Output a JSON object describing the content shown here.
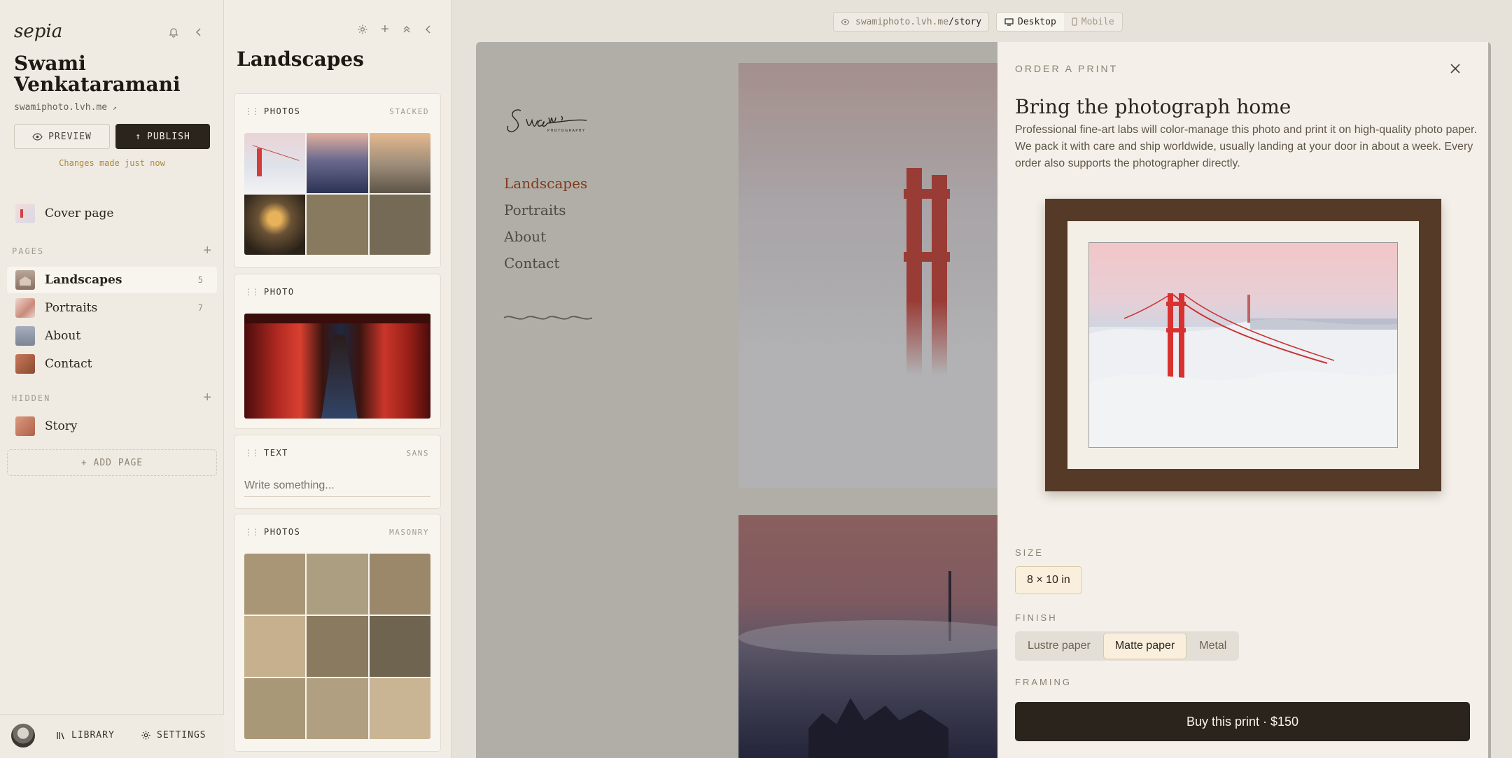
{
  "sidebar": {
    "brand": "sepia",
    "owner_name": "Swami Venkataramani",
    "site_url": "swamiphoto.lvh.me",
    "preview_label": "PREVIEW",
    "publish_label": "PUBLISH",
    "changes_status": "Changes made just now",
    "cover_label": "Cover page",
    "pages_heading": "PAGES",
    "pages": [
      {
        "label": "Landscapes",
        "count": "5"
      },
      {
        "label": "Portraits",
        "count": "7"
      },
      {
        "label": "About",
        "count": ""
      },
      {
        "label": "Contact",
        "count": ""
      }
    ],
    "hidden_heading": "HIDDEN",
    "hidden_pages": [
      {
        "label": "Story"
      }
    ],
    "add_page_label": "+ ADD PAGE",
    "library_label": "LIBRARY",
    "settings_label": "SETTINGS"
  },
  "panel": {
    "title": "Landscapes",
    "blocks": [
      {
        "label": "PHOTOS",
        "tag": "STACKED"
      },
      {
        "label": "PHOTO",
        "tag": ""
      },
      {
        "label": "TEXT",
        "tag": "SANS",
        "placeholder": "Write something..."
      },
      {
        "label": "PHOTOS",
        "tag": "MASONRY"
      }
    ]
  },
  "preview": {
    "url_host": "swamiphoto.lvh.me",
    "url_path": "/story",
    "device_desktop": "Desktop",
    "device_mobile": "Mobile",
    "site_nav": [
      "Landscapes",
      "Portraits",
      "About",
      "Contact"
    ]
  },
  "drawer": {
    "eyebrow": "ORDER A PRINT",
    "title": "Bring the photograph home",
    "description": "Professional fine-art labs will color-manage this photo and print it on high-quality photo paper. We pack it with care and ship worldwide, usually landing at your door in about a week. Every order also supports the photographer directly.",
    "size_label": "SIZE",
    "size_options": [
      "8 × 10 in"
    ],
    "finish_label": "FINISH",
    "finish_options": [
      "Lustre paper",
      "Matte paper",
      "Metal"
    ],
    "finish_selected": "Matte paper",
    "framing_label": "FRAMING",
    "buy_label": "Buy this print · $150"
  },
  "colors": {
    "accent_dark": "#2a241c",
    "status_amber": "#b2873a",
    "active_nav": "#7d3b1d",
    "frame_wood": "#553a28"
  }
}
